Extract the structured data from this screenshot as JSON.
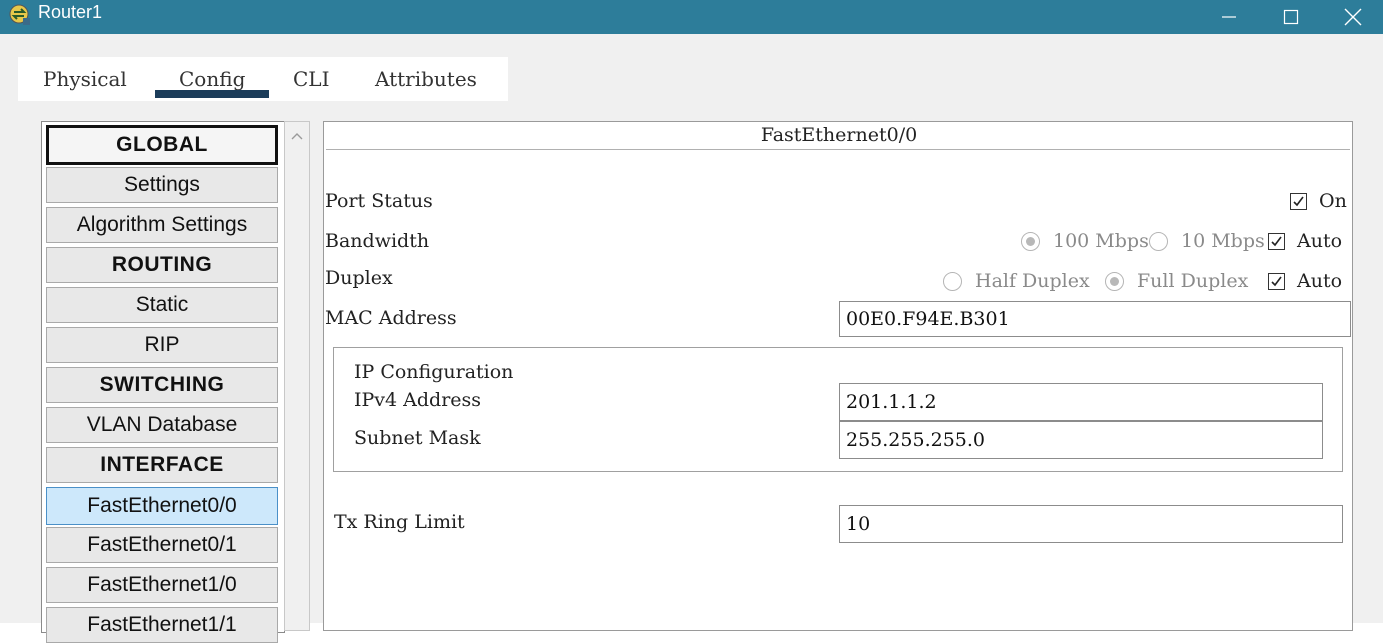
{
  "window": {
    "title": "Router1",
    "icon": "router-app-icon",
    "controls": {
      "minimize": "minimize-icon",
      "maximize": "maximize-icon",
      "close": "close-icon"
    }
  },
  "tabs": [
    {
      "label": "Physical",
      "active": false
    },
    {
      "label": "Config",
      "active": true
    },
    {
      "label": "CLI",
      "active": false
    },
    {
      "label": "Attributes",
      "active": false
    }
  ],
  "sidebar": {
    "items": [
      {
        "label": "GLOBAL",
        "type": "header"
      },
      {
        "label": "Settings",
        "type": "item"
      },
      {
        "label": "Algorithm Settings",
        "type": "item"
      },
      {
        "label": "ROUTING",
        "type": "header"
      },
      {
        "label": "Static",
        "type": "item"
      },
      {
        "label": "RIP",
        "type": "item"
      },
      {
        "label": "SWITCHING",
        "type": "header"
      },
      {
        "label": "VLAN Database",
        "type": "item"
      },
      {
        "label": "INTERFACE",
        "type": "header"
      },
      {
        "label": "FastEthernet0/0",
        "type": "item",
        "selected": true
      },
      {
        "label": "FastEthernet0/1",
        "type": "item"
      },
      {
        "label": "FastEthernet1/0",
        "type": "item"
      },
      {
        "label": "FastEthernet1/1",
        "type": "item"
      }
    ]
  },
  "panel": {
    "title": "FastEthernet0/0",
    "port_status": {
      "label": "Port Status",
      "on_label": "On",
      "on_checked": true
    },
    "bandwidth": {
      "label": "Bandwidth",
      "options": [
        "100 Mbps",
        "10 Mbps"
      ],
      "selected": "100 Mbps",
      "auto_label": "Auto",
      "auto_checked": true
    },
    "duplex": {
      "label": "Duplex",
      "options": [
        "Half Duplex",
        "Full Duplex"
      ],
      "selected": "Full Duplex",
      "auto_label": "Auto",
      "auto_checked": true
    },
    "mac": {
      "label": "MAC Address",
      "value": "00E0.F94E.B301"
    },
    "ip_config": {
      "title": "IP Configuration",
      "ipv4_label": "IPv4 Address",
      "ipv4_value": "201.1.1.2",
      "mask_label": "Subnet Mask",
      "mask_value": "255.255.255.0"
    },
    "tx_ring": {
      "label": "Tx Ring Limit",
      "value": "10"
    }
  },
  "colors": {
    "titlebar": "#2d7d9a",
    "tab_underline": "#1c3d5a",
    "selected_item": "#cde8fb"
  }
}
